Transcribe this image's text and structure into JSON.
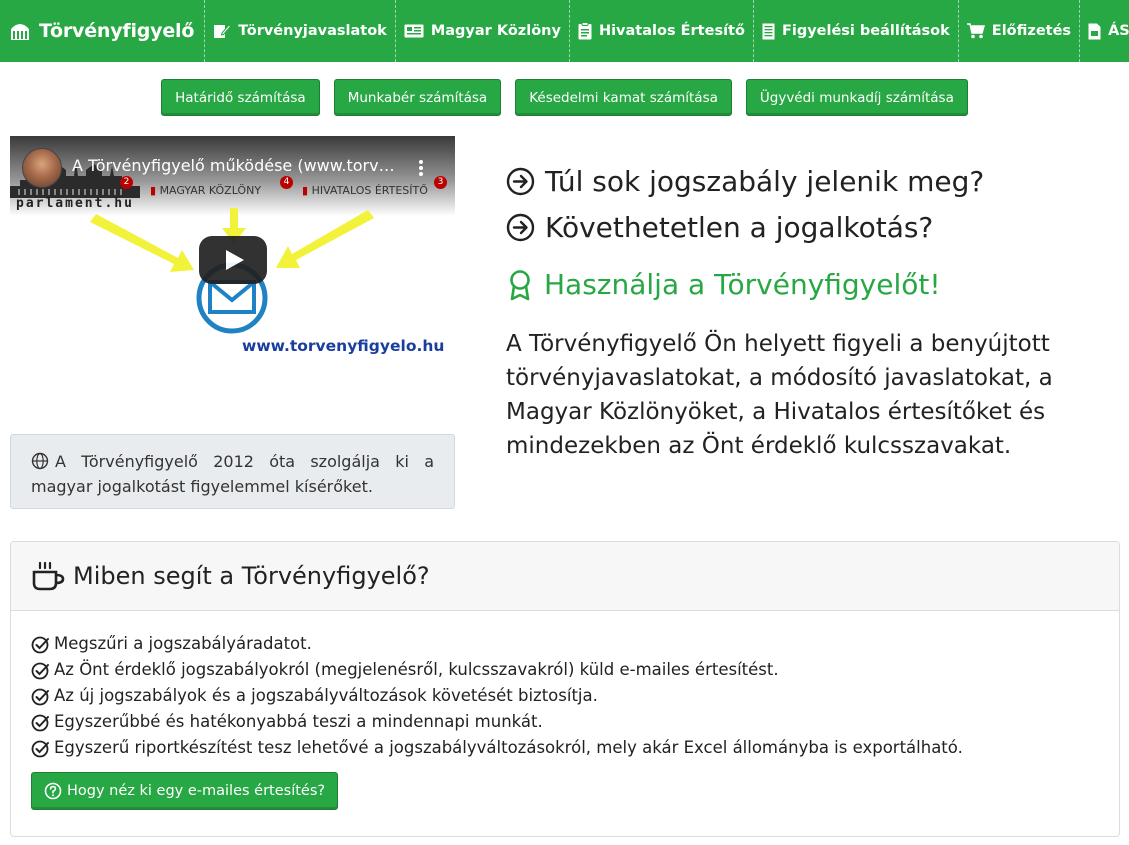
{
  "nav": {
    "brand": "Törvényfigyelő",
    "items": [
      {
        "label": "Törvényjavaslatok",
        "icon": "edit-document-icon"
      },
      {
        "label": "Magyar Közlöny",
        "icon": "newspaper-icon"
      },
      {
        "label": "Hivatalos Értesítő",
        "icon": "clipboard-icon"
      },
      {
        "label": "Figyelési beállítások",
        "icon": "list-icon"
      },
      {
        "label": "Előfizetés",
        "icon": "cart-icon"
      },
      {
        "label": "ÁSZF",
        "icon": "pdf-icon"
      }
    ]
  },
  "calc_buttons": [
    "Határidő számítása",
    "Munkabér számítása",
    "Késedelmi kamat számítása",
    "Ügyvédi munkadíj számítása"
  ],
  "video": {
    "title": "A Törvényfigyelő működése (www.torvenyfigyelo.hu)",
    "source_label": "parlament.hu",
    "tab_kozlony": "MAGYAR KÖZLÖNY",
    "tab_ertesito": "HIVATALOS ÉRTESÍTŐ",
    "badge_1": "2",
    "badge_2": "4",
    "badge_3": "3",
    "url": "www.torvenyfigyelo.hu"
  },
  "info": {
    "text": "A Törvényfigyelő 2012 óta szolgálja ki a magyar jogalkotást figyelemmel kísérőket."
  },
  "hero": {
    "question_1": "Túl sok jogszabály jelenik meg?",
    "question_2": "Követhetetlen a jogalkotás?",
    "cta": "Használja a Törvényfigyelőt!",
    "description": "A Törvényfigyelő Ön helyett figyeli a benyújtott törvényjavaslatokat, a módosító javaslatokat, a Magyar Közlönyöket, a Hivatalos értesítőket és mindezekben az Önt érdeklő kulcsszavakat."
  },
  "card": {
    "title": "Miben segít a Törvényfigyelő?",
    "features": [
      "Megszűri a jogszabályáradatot.",
      "Az Önt érdeklő jogszabályokról (megjelenésről, kulcsszavakról) küld e-mailes értesítést.",
      "Az új jogszabályok és a jogszabályváltozások követését biztosítja.",
      "Egyszerűbbé és hatékonyabbá teszi a mindennapi munkát.",
      "Egyszerű riportkészítést tesz lehetővé a jogszabályváltozásokról, mely akár Excel állományba is exportálható."
    ],
    "demo_button": "Hogy néz ki egy e-mailes értesítés?"
  },
  "colors": {
    "brand_green": "#28a745",
    "url_blue": "#1a3e9e",
    "arrow_yellow": "#f2f23a",
    "mail_blue": "#1e82c4"
  }
}
